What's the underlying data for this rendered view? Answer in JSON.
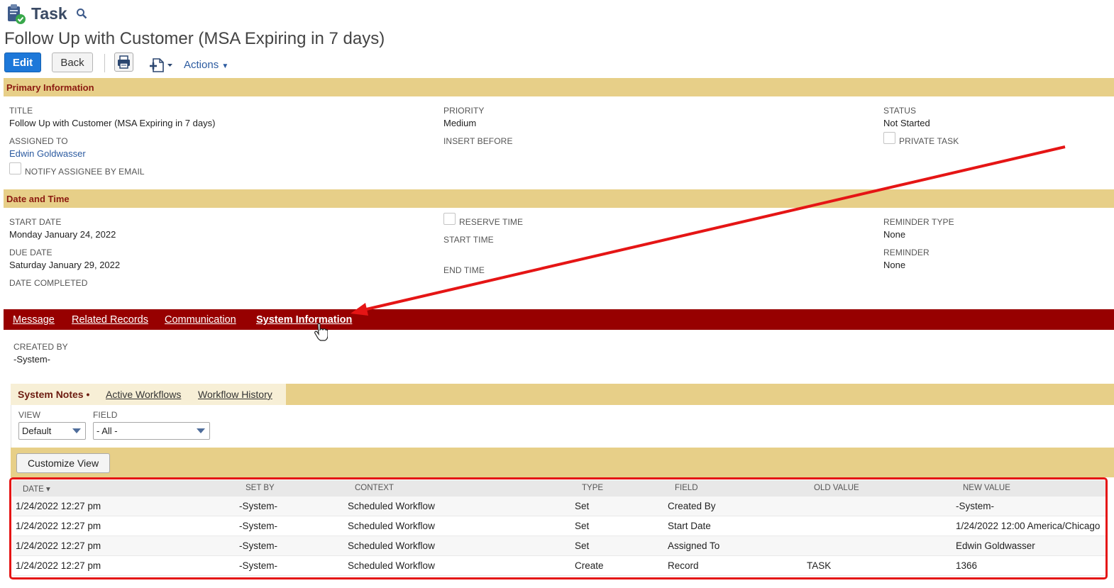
{
  "header": {
    "record_type": "Task",
    "record_title": "Follow Up with Customer (MSA Expiring in 7 days)"
  },
  "toolbar": {
    "edit_label": "Edit",
    "back_label": "Back",
    "actions_label": "Actions"
  },
  "primary": {
    "section_title": "Primary Information",
    "title_label": "TITLE",
    "title_value": "Follow Up with Customer (MSA Expiring in 7 days)",
    "assigned_label": "ASSIGNED TO",
    "assigned_value": "Edwin Goldwasser",
    "notify_label": "NOTIFY ASSIGNEE BY EMAIL",
    "priority_label": "PRIORITY",
    "priority_value": "Medium",
    "insert_before_label": "INSERT BEFORE",
    "status_label": "STATUS",
    "status_value": "Not Started",
    "private_label": "PRIVATE TASK"
  },
  "datetime": {
    "section_title": "Date and Time",
    "start_date_label": "START DATE",
    "start_date_value": "Monday January 24, 2022",
    "due_date_label": "DUE DATE",
    "due_date_value": "Saturday January 29, 2022",
    "date_completed_label": "DATE COMPLETED",
    "reserve_time_label": "RESERVE TIME",
    "start_time_label": "START TIME",
    "end_time_label": "END TIME",
    "reminder_type_label": "REMINDER TYPE",
    "reminder_type_value": "None",
    "reminder_label": "REMINDER",
    "reminder_value": "None"
  },
  "tabs": [
    {
      "label": "Message"
    },
    {
      "label": "Related Records"
    },
    {
      "label": "Communication"
    },
    {
      "label": "System Information"
    }
  ],
  "system_info": {
    "created_by_label": "CREATED BY",
    "created_by_value": "-System-"
  },
  "subtabs": [
    {
      "label": "System Notes"
    },
    {
      "label": "Active Workflows"
    },
    {
      "label": "Workflow History"
    }
  ],
  "filters": {
    "view_label": "VIEW",
    "view_value": "Default",
    "field_label": "FIELD",
    "field_value": "- All -"
  },
  "customize_view_label": "Customize View",
  "table": {
    "columns": [
      "DATE ▾",
      "SET BY",
      "CONTEXT",
      "TYPE",
      "FIELD",
      "OLD VALUE",
      "NEW VALUE"
    ],
    "rows": [
      [
        "1/24/2022 12:27 pm",
        "-System-",
        "Scheduled Workflow",
        "Set",
        "Created By",
        "",
        "-System-"
      ],
      [
        "1/24/2022 12:27 pm",
        "-System-",
        "Scheduled Workflow",
        "Set",
        "Start Date",
        "",
        "1/24/2022 12:00 America/Chicago"
      ],
      [
        "1/24/2022 12:27 pm",
        "-System-",
        "Scheduled Workflow",
        "Set",
        "Assigned To",
        "",
        "Edwin Goldwasser"
      ],
      [
        "1/24/2022 12:27 pm",
        "-System-",
        "Scheduled Workflow",
        "Create",
        "Record",
        "TASK",
        "1366"
      ]
    ]
  },
  "colors": {
    "section_bar": "#e7cf88",
    "section_title": "#8b1a10",
    "tab_bar": "#970000",
    "edit_button": "#1d78d9",
    "link": "#2c5ba0",
    "annotation": "#e51515"
  }
}
